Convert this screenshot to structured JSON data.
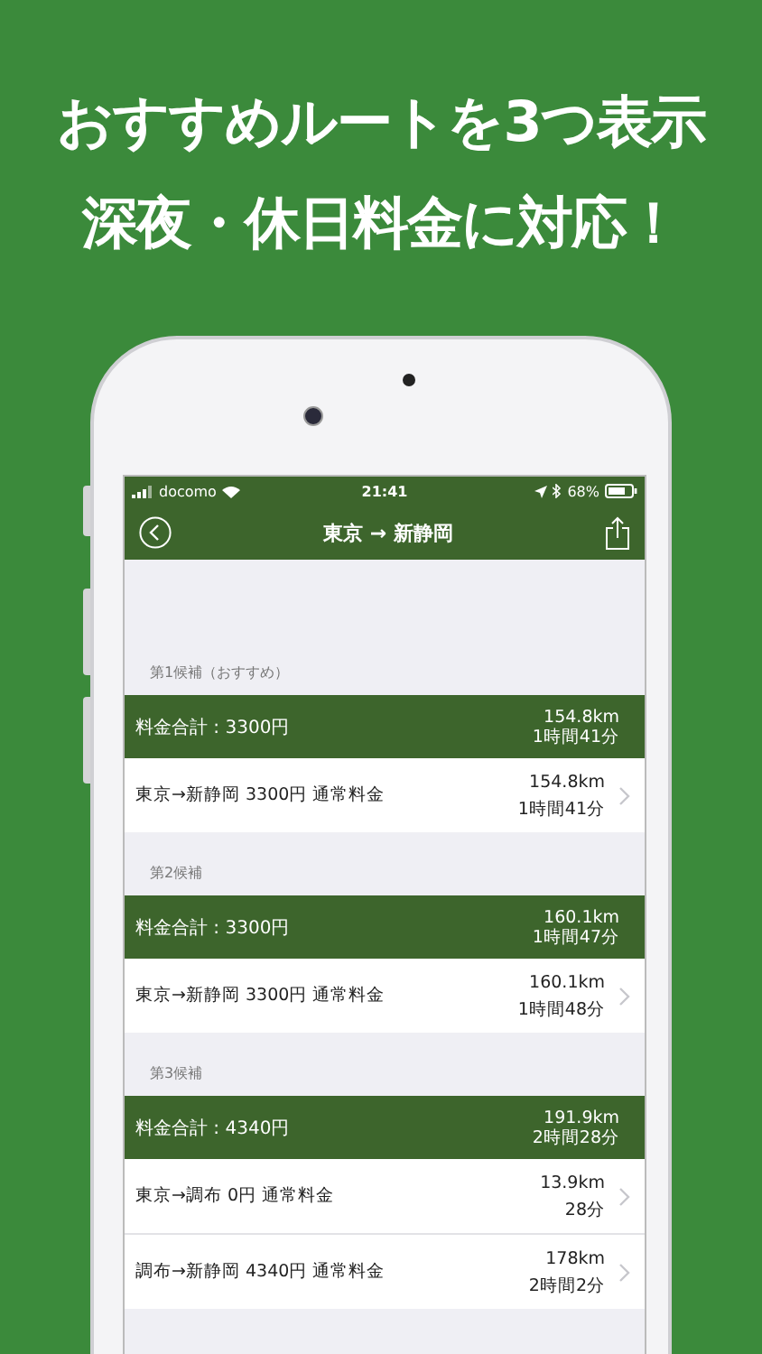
{
  "headline": [
    "おすすめルートを3つ表示",
    "深夜・休日料金に対応！"
  ],
  "status_bar": {
    "carrier": "docomo",
    "time": "21:41",
    "battery": "68%"
  },
  "nav": {
    "title": "東京 → 新静岡"
  },
  "routes": [
    {
      "header": "第1候補（おすすめ）",
      "total": "料金合計 : 3300円",
      "distance": "154.8km",
      "duration": "1時間41分",
      "legs": [
        {
          "label": "東京→新静岡 3300円 通常料金",
          "distance": "154.8km",
          "duration": "1時間41分"
        }
      ]
    },
    {
      "header": "第2候補",
      "total": "料金合計 : 3300円",
      "distance": "160.1km",
      "duration": "1時間47分",
      "legs": [
        {
          "label": "東京→新静岡 3300円 通常料金",
          "distance": "160.1km",
          "duration": "1時間48分"
        }
      ]
    },
    {
      "header": "第3候補",
      "total": "料金合計 : 4340円",
      "distance": "191.9km",
      "duration": "2時間28分",
      "legs": [
        {
          "label": "東京→調布 0円 通常料金",
          "distance": "13.9km",
          "duration": "28分"
        },
        {
          "label": "調布→新静岡 4340円 通常料金",
          "distance": "178km",
          "duration": "2時間2分"
        }
      ]
    }
  ]
}
